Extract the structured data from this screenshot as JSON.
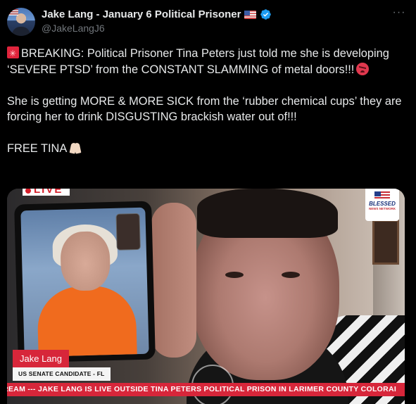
{
  "author": {
    "display_name": "Jake Lang - January 6 Political Prisoner",
    "handle": "@JakeLangJ6",
    "flag_icon": "us-flag-icon",
    "verified_icon": "verified-badge-icon",
    "verified_color": "#1d9bf0"
  },
  "menu": {
    "more_label": "···"
  },
  "tweet": {
    "line1_prefix": "BREAKING: Political Prisoner Tina Peters just told me she is developing ‘SEVERE PTSD’ from the CONSTANT SLAMMING of metal doors!!!",
    "line2": "She is getting MORE & MORE SICK from the ‘rubber chemical cups’ they are forcing her to drink DISGUSTING brackish water out of!!!",
    "line3": "FREE TINA",
    "emojis": [
      "siren-emoji",
      "angry-face-emoji",
      "praying-hands-emoji"
    ]
  },
  "media": {
    "live_label": "LIVE",
    "network_logo_main": "BLESSED",
    "network_logo_sub": "NEWS NETWORK",
    "lower_third_name": "Jake Lang",
    "lower_third_title": "US SENATE CANDIDATE - FL",
    "ticker_text": "REAM --- JAKE LANG IS LIVE OUTSIDE TINA PETERS POLITICAL PRISON IN LARIMER COUNTY COLORAI",
    "accent_red": "#d7263a"
  },
  "colors": {
    "background": "#000000",
    "text_primary": "#e7e9ea",
    "text_secondary": "#71767b"
  }
}
